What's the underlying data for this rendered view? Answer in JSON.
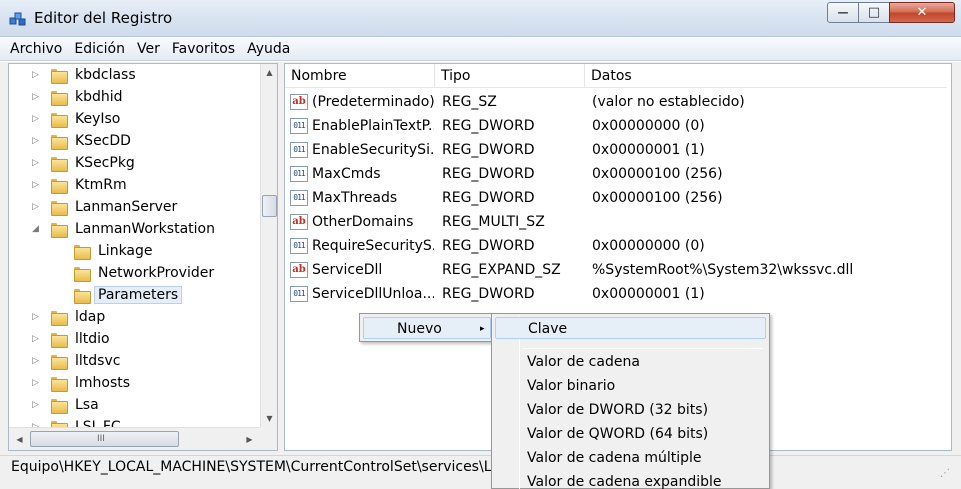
{
  "window": {
    "title": "Editor del Registro",
    "min_symbol": "—",
    "max_symbol": "□",
    "close_symbol": "✕"
  },
  "menu": [
    "Archivo",
    "Edición",
    "Ver",
    "Favoritos",
    "Ayuda"
  ],
  "tree": {
    "items": [
      {
        "label": "kbdclass",
        "arrow": "▷"
      },
      {
        "label": "kbdhid",
        "arrow": "▷"
      },
      {
        "label": "KeyIso",
        "arrow": "▷"
      },
      {
        "label": "KSecDD",
        "arrow": "▷"
      },
      {
        "label": "KSecPkg",
        "arrow": "▷"
      },
      {
        "label": "KtmRm",
        "arrow": "▷"
      },
      {
        "label": "LanmanServer",
        "arrow": "▷"
      },
      {
        "label": "LanmanWorkstation",
        "arrow": "◢"
      },
      {
        "label": "Linkage",
        "arrow": ""
      },
      {
        "label": "NetworkProvider",
        "arrow": ""
      },
      {
        "label": "Parameters",
        "arrow": "",
        "selected": true
      },
      {
        "label": "ldap",
        "arrow": "▷"
      },
      {
        "label": "lltdio",
        "arrow": "▷"
      },
      {
        "label": "lltdsvc",
        "arrow": "▷"
      },
      {
        "label": "lmhosts",
        "arrow": "▷"
      },
      {
        "label": "Lsa",
        "arrow": "▷"
      },
      {
        "label": "LSI_FC",
        "arrow": "▷"
      }
    ],
    "hscroll_grip": "III"
  },
  "list": {
    "headers": {
      "name": "Nombre",
      "type": "Tipo",
      "data": "Datos"
    },
    "rows": [
      {
        "icon": "string-value-icon",
        "glyph": "ab",
        "name": "(Predeterminado)",
        "type": "REG_SZ",
        "data": "(valor no establecido)"
      },
      {
        "icon": "binary-value-icon",
        "glyph": "011",
        "name": "EnablePlainTextP...",
        "type": "REG_DWORD",
        "data": "0x00000000 (0)"
      },
      {
        "icon": "binary-value-icon",
        "glyph": "011",
        "name": "EnableSecuritySi...",
        "type": "REG_DWORD",
        "data": "0x00000001 (1)"
      },
      {
        "icon": "binary-value-icon",
        "glyph": "011",
        "name": "MaxCmds",
        "type": "REG_DWORD",
        "data": "0x00000100 (256)"
      },
      {
        "icon": "binary-value-icon",
        "glyph": "011",
        "name": "MaxThreads",
        "type": "REG_DWORD",
        "data": "0x00000100 (256)"
      },
      {
        "icon": "string-value-icon",
        "glyph": "ab",
        "name": "OtherDomains",
        "type": "REG_MULTI_SZ",
        "data": ""
      },
      {
        "icon": "binary-value-icon",
        "glyph": "011",
        "name": "RequireSecurityS...",
        "type": "REG_DWORD",
        "data": "0x00000000 (0)"
      },
      {
        "icon": "string-value-icon",
        "glyph": "ab",
        "name": "ServiceDll",
        "type": "REG_EXPAND_SZ",
        "data": "%SystemRoot%\\System32\\wkssvc.dll"
      },
      {
        "icon": "binary-value-icon",
        "glyph": "011",
        "name": "ServiceDllUnloa...",
        "type": "REG_DWORD",
        "data": "0x00000001 (1)"
      }
    ]
  },
  "context_menu": {
    "nuevo": {
      "label": "Nuevo",
      "arrow": "▸"
    },
    "submenu": [
      "Clave",
      "Valor de cadena",
      "Valor binario",
      "Valor de DWORD (32 bits)",
      "Valor de QWORD (64 bits)",
      "Valor de cadena múltiple",
      "Valor de cadena expandible"
    ]
  },
  "status": {
    "path": "Equipo\\HKEY_LOCAL_MACHINE\\SYSTEM\\CurrentControlSet\\services\\Lan"
  }
}
